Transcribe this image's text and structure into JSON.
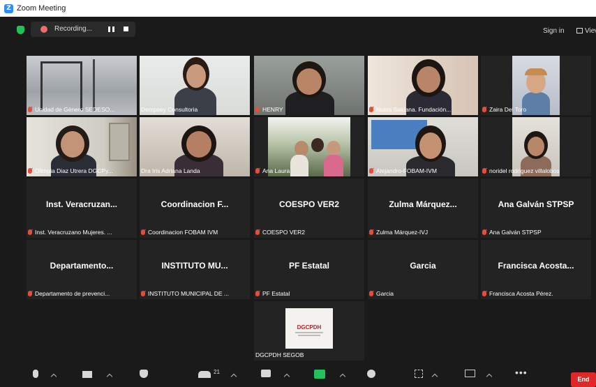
{
  "window": {
    "title": "Zoom Meeting",
    "logo_letter": "Z"
  },
  "topbar": {
    "recording_label": "Recording...",
    "sign_in_label": "Sign in",
    "view_label": "View"
  },
  "participants": [
    {
      "name": "Unidad de Género SEDESO...",
      "muted": true,
      "type": "video"
    },
    {
      "name": "Dempsey Consultoria",
      "muted": false,
      "type": "video",
      "speaking": true
    },
    {
      "name": "HENRY",
      "muted": true,
      "type": "video"
    },
    {
      "name": "Nubia Saldana. Fundación...",
      "muted": true,
      "type": "video"
    },
    {
      "name": "Zaira Del Toro",
      "muted": true,
      "type": "video"
    },
    {
      "name": "Olimpia Diaz Utrera DGCPy...",
      "muted": true,
      "type": "video"
    },
    {
      "name": "Dra Iris Adriana Landa",
      "muted": false,
      "type": "video"
    },
    {
      "name": "Ana Laura",
      "muted": true,
      "type": "video"
    },
    {
      "name": "Alejandro-FOBAM-IVM",
      "muted": true,
      "type": "video"
    },
    {
      "name": "noridel rodriguez villalobos",
      "muted": true,
      "type": "video"
    },
    {
      "display": "Inst. Veracruzan...",
      "name": "Inst. Veracruzano Mujeres. ...",
      "muted": true,
      "type": "name"
    },
    {
      "display": "Coordinacion F...",
      "name": "Coordinacion FOBAM IVM",
      "muted": true,
      "type": "name"
    },
    {
      "display": "COESPO VER2",
      "name": "COESPO VER2",
      "muted": true,
      "type": "name"
    },
    {
      "display": "Zulma Márquez...",
      "name": "Zulma Márquez-IVJ",
      "muted": true,
      "type": "name"
    },
    {
      "display": "Ana Galván STPSP",
      "name": "Ana Galván STPSP",
      "muted": true,
      "type": "name"
    },
    {
      "display": "Departamento...",
      "name": "Departamento de prevenci...",
      "muted": true,
      "type": "name"
    },
    {
      "display": "INSTITUTO MU...",
      "name": "INSTITUTO MUNICIPAL DE ...",
      "muted": true,
      "type": "name"
    },
    {
      "display": "PF Estatal",
      "name": "PF Estatal",
      "muted": true,
      "type": "name"
    },
    {
      "display": "Garcia",
      "name": "Garcia",
      "muted": true,
      "type": "name"
    },
    {
      "display": "Francisca Acosta...",
      "name": "Francisca Acosta Pérez.",
      "muted": true,
      "type": "name"
    },
    {
      "name": "DGCPDH SEGOB",
      "muted": false,
      "type": "logo",
      "logo_text": "DGCPDH"
    }
  ],
  "toolbar": {
    "participants_count": "21",
    "end_label": "End"
  }
}
